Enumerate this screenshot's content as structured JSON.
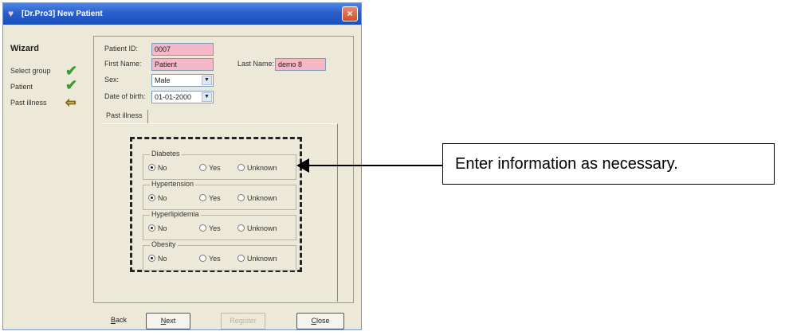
{
  "window": {
    "title": "[Dr.Pro3] New Patient",
    "close_glyph": "×"
  },
  "wizard": {
    "title": "Wizard",
    "steps": [
      {
        "label": "Select group",
        "status_icon": "check-icon"
      },
      {
        "label": "Patient",
        "status_icon": "check-icon"
      },
      {
        "label": "Past illness",
        "status_icon": "arrow-left-icon"
      }
    ]
  },
  "form": {
    "patient_id_label": "Patient ID:",
    "patient_id_value": "0007",
    "first_name_label": "First Name:",
    "first_name_value": "Patient",
    "last_name_label": "Last Name:",
    "last_name_value": "demo 8",
    "sex_label": "Sex:",
    "sex_value": "Male",
    "dob_label": "Date of birth:",
    "dob_value": "01-01-2000"
  },
  "tabs": [
    {
      "label": "Past illness"
    }
  ],
  "illness_groups": [
    {
      "title": "Diabetes",
      "selected": "No"
    },
    {
      "title": "Hypertension",
      "selected": "No"
    },
    {
      "title": "Hyperlipidemia",
      "selected": "No"
    },
    {
      "title": "Obesity",
      "selected": "No"
    }
  ],
  "radio_options": {
    "no": "No",
    "yes": "Yes",
    "unknown": "Unknown"
  },
  "buttons": {
    "back": "Back",
    "next": "Next",
    "register": "Register",
    "close": "Close"
  },
  "callout": {
    "text": "Enter information as necessary."
  },
  "colors": {
    "required_field": "#f6b7c6",
    "titlebar": "#2a5fc9",
    "check": "#3c9c2a",
    "step_arrow": "#e2c020"
  }
}
